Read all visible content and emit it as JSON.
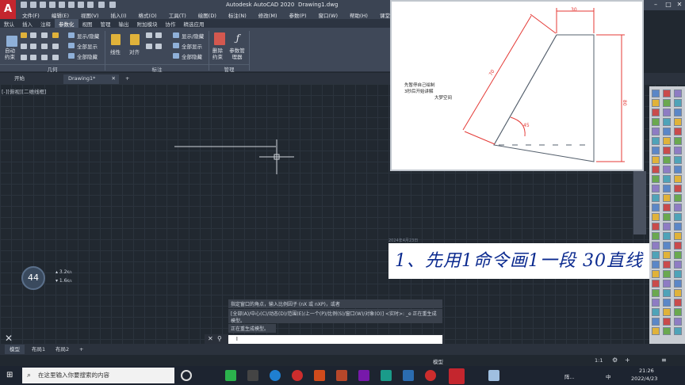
{
  "window": {
    "app_title": "Autodesk AutoCAD 2020",
    "doc_title": "Drawing1.dwg"
  },
  "menu": [
    "文件(F)",
    "编辑(E)",
    "视图(V)",
    "插入(I)",
    "格式(O)",
    "工具(T)",
    "绘图(D)",
    "标注(N)",
    "修改(M)",
    "参数(P)",
    "窗口(W)",
    "帮助(H)",
    "课堂设计"
  ],
  "ribbon_tabs": [
    "默认",
    "插入",
    "注释",
    "参数化",
    "视图",
    "管理",
    "输出",
    "附加模块",
    "协作",
    "精选应用"
  ],
  "ribbon": {
    "auto_constrain": "自动约束",
    "geometric_group": "几何",
    "show_hide": "显示/隐藏",
    "show_all": "全部显示",
    "hide_all": "全部隐藏",
    "linear": "线性",
    "aligned": "对齐",
    "dim_group": "标注",
    "delete_constraint": "删除约束",
    "param_manager": "参数管理器",
    "manage_group": "管理"
  },
  "doc_tabs": {
    "start": "开始",
    "drawing": "Drawing1*",
    "add": "+"
  },
  "viewport_label": "[-][俯视][二维线框]",
  "reference": {
    "dim_top": "30",
    "dim_left": "70",
    "dim_right": "80",
    "dim_angle": "45",
    "note_line1": "先暂停自己绘制",
    "note_line2": "3秒后开始讲解",
    "note_line3": "大梦空间"
  },
  "handwritten_note": "1、先用1命令画1一段 30直线",
  "note_date": "2024年4月23日",
  "network": {
    "percent": "44",
    "up": "3.2",
    "down": "1.6",
    "unit": "K/s"
  },
  "command": {
    "line1": "指定窗口的角点，输入比例因子 (nX 或 nXP)，或者",
    "line2": "[全部(A)/中心(C)/动态(D)/范围(E)/上一个(P)/比例(S)/窗口(W)/对象(O)] <实时>: _e 正在重生成模型。",
    "line3": "正在重生成模型。",
    "input_value": "l"
  },
  "layout_tabs": [
    "模型",
    "布局1",
    "布局2",
    "+"
  ],
  "status": {
    "model": "模型",
    "scale": "1:1"
  },
  "taskbar": {
    "search_placeholder": "在这里输入你要搜索的内容",
    "weather": "阵...",
    "ime": "中",
    "time": "21:26",
    "date": "2022/4/23"
  },
  "colors": {
    "accent_red": "#c4262e",
    "sketch_red": "#e43a36",
    "note_blue": "#0b2a8f"
  }
}
